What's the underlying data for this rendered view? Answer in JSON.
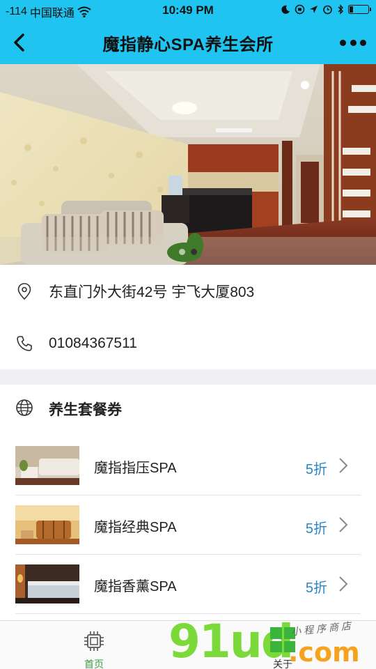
{
  "status_bar": {
    "signal": "-114",
    "carrier": "中国联通",
    "time": "10:49 PM",
    "battery_level": 0.2
  },
  "nav": {
    "title": "魔指静心SPA养生会所",
    "background": "#1fc4f0",
    "back_icon": "chevron-left-icon",
    "more_icon": "ellipsis-icon"
  },
  "hero": {
    "slide_count": 2,
    "active_slide": 1
  },
  "info": {
    "address": "东直门外大街42号 宇飞大厦803",
    "phone": "01084367511"
  },
  "coupons": {
    "title": "养生套餐券",
    "items": [
      {
        "name": "魔指指压SPA",
        "discount": "5折"
      },
      {
        "name": "魔指经典SPA",
        "discount": "5折"
      },
      {
        "name": "魔指香薰SPA",
        "discount": "5折"
      }
    ],
    "discount_color": "#2a86c6"
  },
  "tabs": {
    "home": "首页",
    "about": "关于",
    "active_color": "#3aa040"
  },
  "watermark": {
    "brand": "91ud",
    "suffix": ".com",
    "tagline": "小程序商店"
  }
}
